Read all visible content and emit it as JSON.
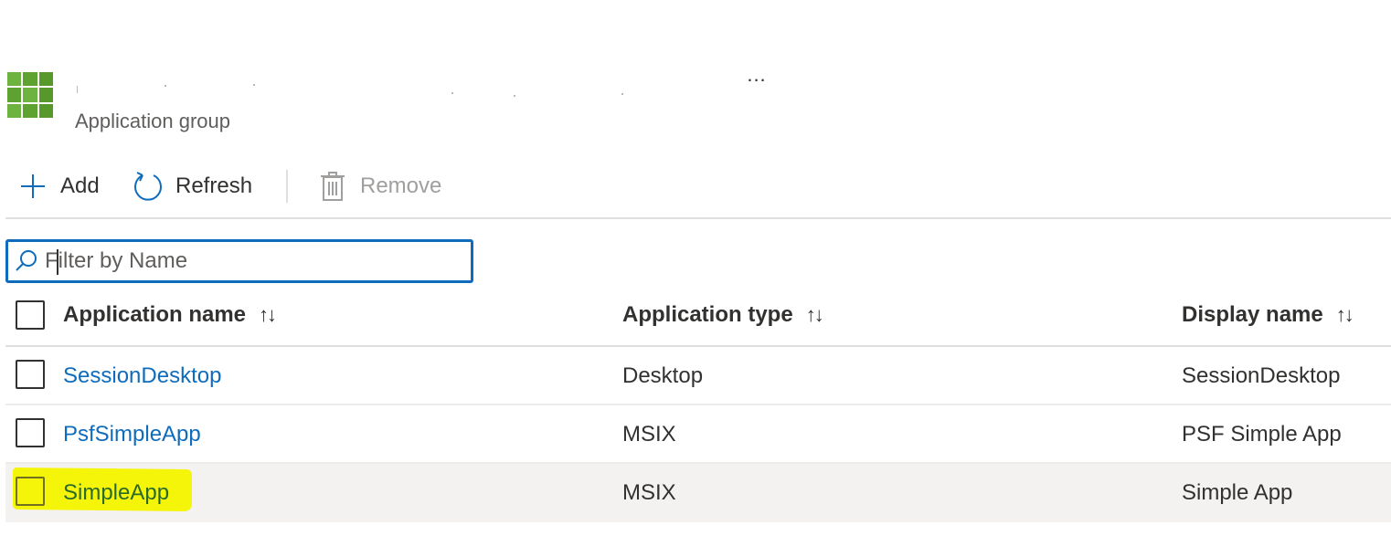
{
  "header": {
    "more_label": "...",
    "subtitle": "Application group"
  },
  "toolbar": {
    "add_label": "Add",
    "refresh_label": "Refresh",
    "remove_label": "Remove"
  },
  "filter": {
    "placeholder": "Filter by Name",
    "value": ""
  },
  "table": {
    "columns": [
      "Application name",
      "Application type",
      "Display name"
    ],
    "sort_glyph": "↑↓",
    "rows": [
      {
        "name": "SessionDesktop",
        "type": "Desktop",
        "display": "SessionDesktop"
      },
      {
        "name": "PsfSimpleApp",
        "type": "MSIX",
        "display": "PSF Simple App"
      },
      {
        "name": "SimpleApp",
        "type": "MSIX",
        "display": "Simple App"
      }
    ]
  },
  "colors": {
    "accent": "#0f6cbd",
    "icon_green": "#6cb33f",
    "highlight_yellow": "#f5f50a",
    "row_highlight": "#f3f2f1"
  },
  "icons": {
    "app_group": "app-grid-icon",
    "add": "plus-icon",
    "refresh": "refresh-icon",
    "remove": "trash-icon",
    "search": "search-icon"
  }
}
